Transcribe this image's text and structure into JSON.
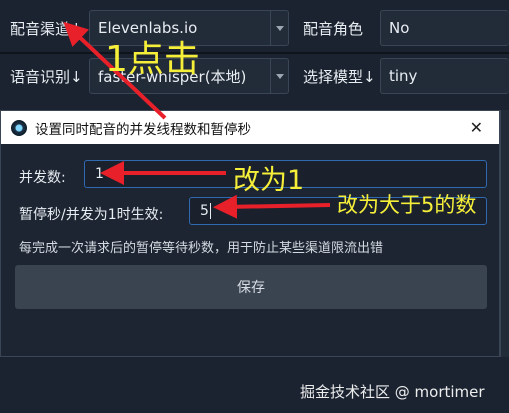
{
  "background": {
    "row1": {
      "channel_label": "配音渠道↓",
      "channel_value": "Elevenlabs.io",
      "role_label": "配音角色",
      "role_value": "No"
    },
    "row2": {
      "recognition_label": "语音识别↓",
      "recognition_value": "faster-whisper(本地)",
      "model_label": "选择模型↓",
      "model_value": "tiny"
    }
  },
  "dialog": {
    "title": "设置同时配音的并发线程数和暂停秒",
    "close_glyph": "✕",
    "concurrency_label": "并发数:",
    "concurrency_value": "1",
    "pause_label": "暂停秒/并发为1时生效:",
    "pause_value": "5",
    "hint": "每完成一次请求后的暂停等待秒数，用于防止某些渠道限流出错",
    "save_label": "保存"
  },
  "annotations": {
    "click": "1点击",
    "set_to_1": "改为1",
    "set_gt_5": "改为大于5的数",
    "color": "#f6ef3a",
    "arrow_color": "#e8202a"
  },
  "watermark": "掘金技术社区 @ mortimer"
}
